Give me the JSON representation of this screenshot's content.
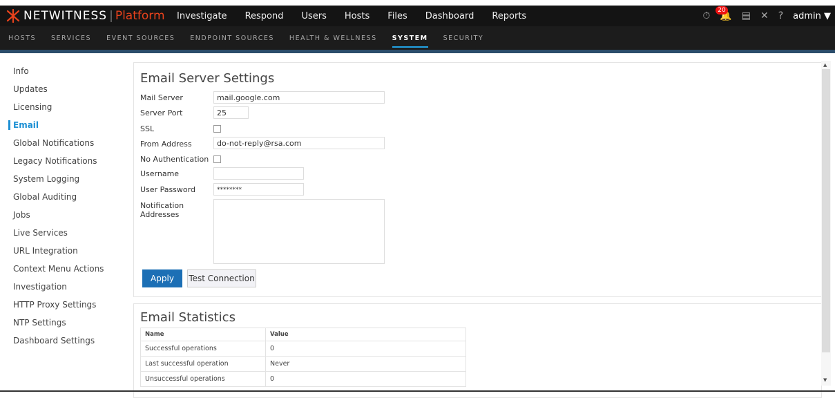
{
  "app": {
    "brand": "NETWITNESS",
    "sep": "|",
    "platform": "Platform"
  },
  "top_nav": [
    "Investigate",
    "Respond",
    "Users",
    "Hosts",
    "Files",
    "Dashboard",
    "Reports"
  ],
  "top_icons": {
    "notifications_count": "20",
    "user": "admin",
    "help": "?"
  },
  "sub_nav": [
    "HOSTS",
    "SERVICES",
    "EVENT SOURCES",
    "ENDPOINT SOURCES",
    "HEALTH & WELLNESS",
    "SYSTEM",
    "SECURITY"
  ],
  "sub_nav_active": "SYSTEM",
  "sidebar": [
    "Info",
    "Updates",
    "Licensing",
    "Email",
    "Global Notifications",
    "Legacy Notifications",
    "System Logging",
    "Global Auditing",
    "Jobs",
    "Live Services",
    "URL Integration",
    "Context Menu Actions",
    "Investigation",
    "HTTP Proxy Settings",
    "NTP Settings",
    "Dashboard Settings"
  ],
  "sidebar_active": "Email",
  "email_settings": {
    "title": "Email Server Settings",
    "mail_server_label": "Mail Server",
    "mail_server_value": "mail.google.com",
    "port_label": "Server Port",
    "port_value": "25",
    "ssl_label": "SSL",
    "from_label": "From Address",
    "from_value": "do-not-reply@rsa.com",
    "noauth_label": "No Authentication",
    "username_label": "Username",
    "username_value": "",
    "password_label": "User Password",
    "password_value": "********",
    "notif_label_1": "Notification",
    "notif_label_2": "Addresses",
    "apply_label": "Apply",
    "test_label": "Test Connection"
  },
  "email_stats": {
    "title": "Email Statistics",
    "headers": [
      "Name",
      "Value"
    ],
    "rows": [
      [
        "Successful operations",
        "0"
      ],
      [
        "Last successful operation",
        "Never"
      ],
      [
        "Unsuccessful operations",
        "0"
      ]
    ]
  },
  "colors": {
    "accent": "#1d90d4",
    "brand_orange": "#e8421c",
    "apply_button": "#1c6fb5"
  }
}
